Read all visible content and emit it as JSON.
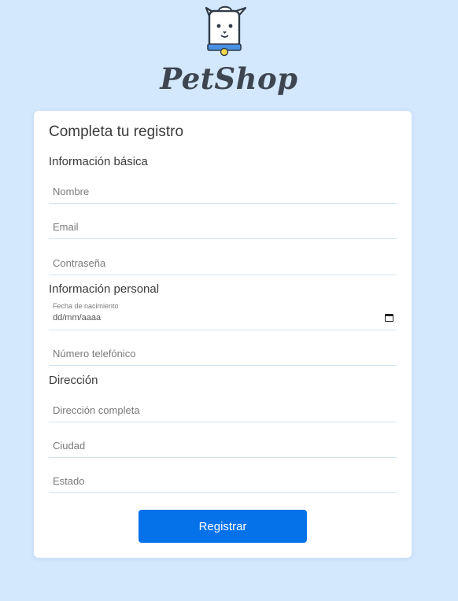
{
  "brand": {
    "name": "PetShop",
    "logo_icon": "dog-with-collar-icon",
    "colors": {
      "background": "#d3e7fd",
      "primary": "#0672ea",
      "collar": "#4a90e2",
      "tag": "#f5d84a"
    }
  },
  "form": {
    "title": "Completa tu registro",
    "sections": {
      "basic": "Información básica",
      "personal": "Información personal",
      "address": "Dirección"
    },
    "fields": {
      "nombre": {
        "placeholder": "Nombre"
      },
      "email": {
        "placeholder": "Email"
      },
      "password": {
        "placeholder": "Contraseña"
      },
      "birthdate": {
        "label": "Fecha de nacimiento",
        "value": "dd/mm/aaaa",
        "icon": "calendar-icon"
      },
      "phone": {
        "placeholder": "Número telefónico"
      },
      "full_address": {
        "placeholder": "Dirección completa"
      },
      "city": {
        "placeholder": "Ciudad"
      },
      "state": {
        "placeholder": "Estado"
      }
    },
    "submit_label": "Registrar"
  }
}
